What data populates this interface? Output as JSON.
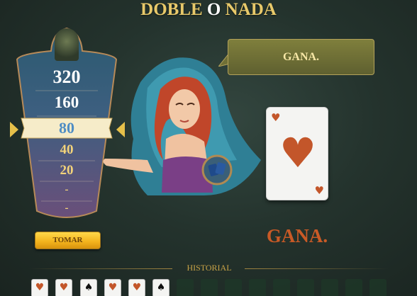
{
  "game": {
    "title_left": "DOBLE",
    "title_middle": "O",
    "title_right": "NADA"
  },
  "ladder": {
    "rungs": [
      "320",
      "160",
      "80",
      "40",
      "20",
      "-",
      "-"
    ],
    "current_index": 2
  },
  "take_button": {
    "label": "TOMAR"
  },
  "speech": {
    "text": "GANA."
  },
  "card": {
    "suit": "hearts",
    "suit_glyph": "♥",
    "color": "#c3562a"
  },
  "result": {
    "text": "GANA.",
    "color": "#c95a26"
  },
  "history": {
    "label": "HISTORIAL",
    "cards": [
      {
        "glyph": "♥",
        "color": "red"
      },
      {
        "glyph": "♥",
        "color": "red"
      },
      {
        "glyph": "♠",
        "color": "black"
      },
      {
        "glyph": "♥",
        "color": "red"
      },
      {
        "glyph": "♥",
        "color": "red"
      },
      {
        "glyph": "♠",
        "color": "black"
      }
    ],
    "empty_slots": 9
  }
}
